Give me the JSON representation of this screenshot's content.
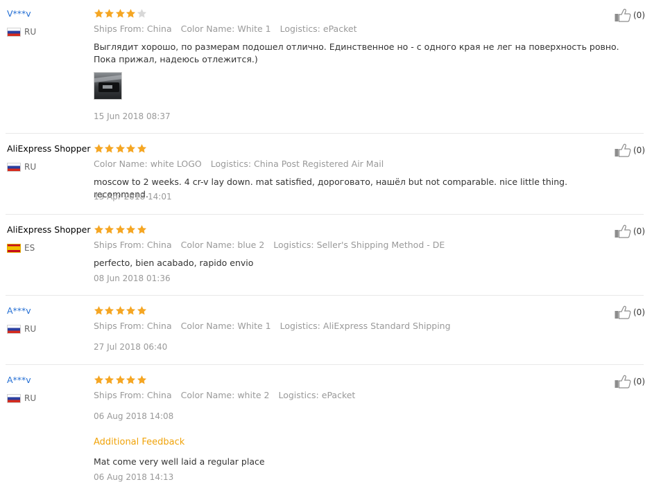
{
  "reviews": [
    {
      "user": "V***v",
      "country": "RU",
      "stars": 4,
      "attrs": [
        {
          "k": "Ships From:",
          "v": "China"
        },
        {
          "k": "Color Name:",
          "v": "White 1"
        },
        {
          "k": "Logistics:",
          "v": "ePacket"
        }
      ],
      "text": "Выглядит хорошо, по размерам подошел отлично. Единственное но - с одного края не лег на поверхность ровно. Пока прижал, надеюсь отлежится.)",
      "date": "15 Jun 2018 08:37",
      "likes": "(0)"
    },
    {
      "user": "AliExpress Shopper",
      "country": "RU",
      "stars": 5,
      "attrs": [
        {
          "k": "Color Name:",
          "v": "white LOGO"
        },
        {
          "k": "Logistics:",
          "v": "China Post Registered Air Mail"
        }
      ],
      "text": "moscow to 2 weeks. 4 cr-v lay down. mat satisfied, дороговато, нашёл but not comparable. nice little thing. recommend.",
      "date": "13 Apr 2018 14:01",
      "likes": "(0)"
    },
    {
      "user": "AliExpress Shopper",
      "country": "ES",
      "stars": 5,
      "attrs": [
        {
          "k": "Ships From:",
          "v": "China"
        },
        {
          "k": "Color Name:",
          "v": "blue 2"
        },
        {
          "k": "Logistics:",
          "v": "Seller's Shipping Method - DE"
        }
      ],
      "text": "perfecto, bien acabado, rapido envio",
      "date": "08 Jun 2018 01:36",
      "likes": "(0)"
    },
    {
      "user": "A***v",
      "country": "RU",
      "stars": 5,
      "attrs": [
        {
          "k": "Ships From:",
          "v": "China"
        },
        {
          "k": "Color Name:",
          "v": "White 1"
        },
        {
          "k": "Logistics:",
          "v": "AliExpress Standard Shipping"
        }
      ],
      "text": "",
      "date": "27 Jul 2018 06:40",
      "likes": "(0)"
    },
    {
      "user": "A***v",
      "country": "RU",
      "stars": 5,
      "attrs": [
        {
          "k": "Ships From:",
          "v": "China"
        },
        {
          "k": "Color Name:",
          "v": "white 2"
        },
        {
          "k": "Logistics:",
          "v": "ePacket"
        }
      ],
      "text": "",
      "date": "06 Aug 2018 14:08",
      "likes": "(0)",
      "additional_label": "Additional Feedback",
      "additional_text": "Mat come very well laid a regular place",
      "additional_date": "06 Aug 2018 14:13"
    }
  ],
  "colors": {
    "star_on": "#f5a623",
    "star_off": "#d8d8d8",
    "link": "#2670d4",
    "additional": "#f0a30a"
  },
  "icons": {
    "star": "star-icon",
    "like": "thumbs-up-icon"
  }
}
